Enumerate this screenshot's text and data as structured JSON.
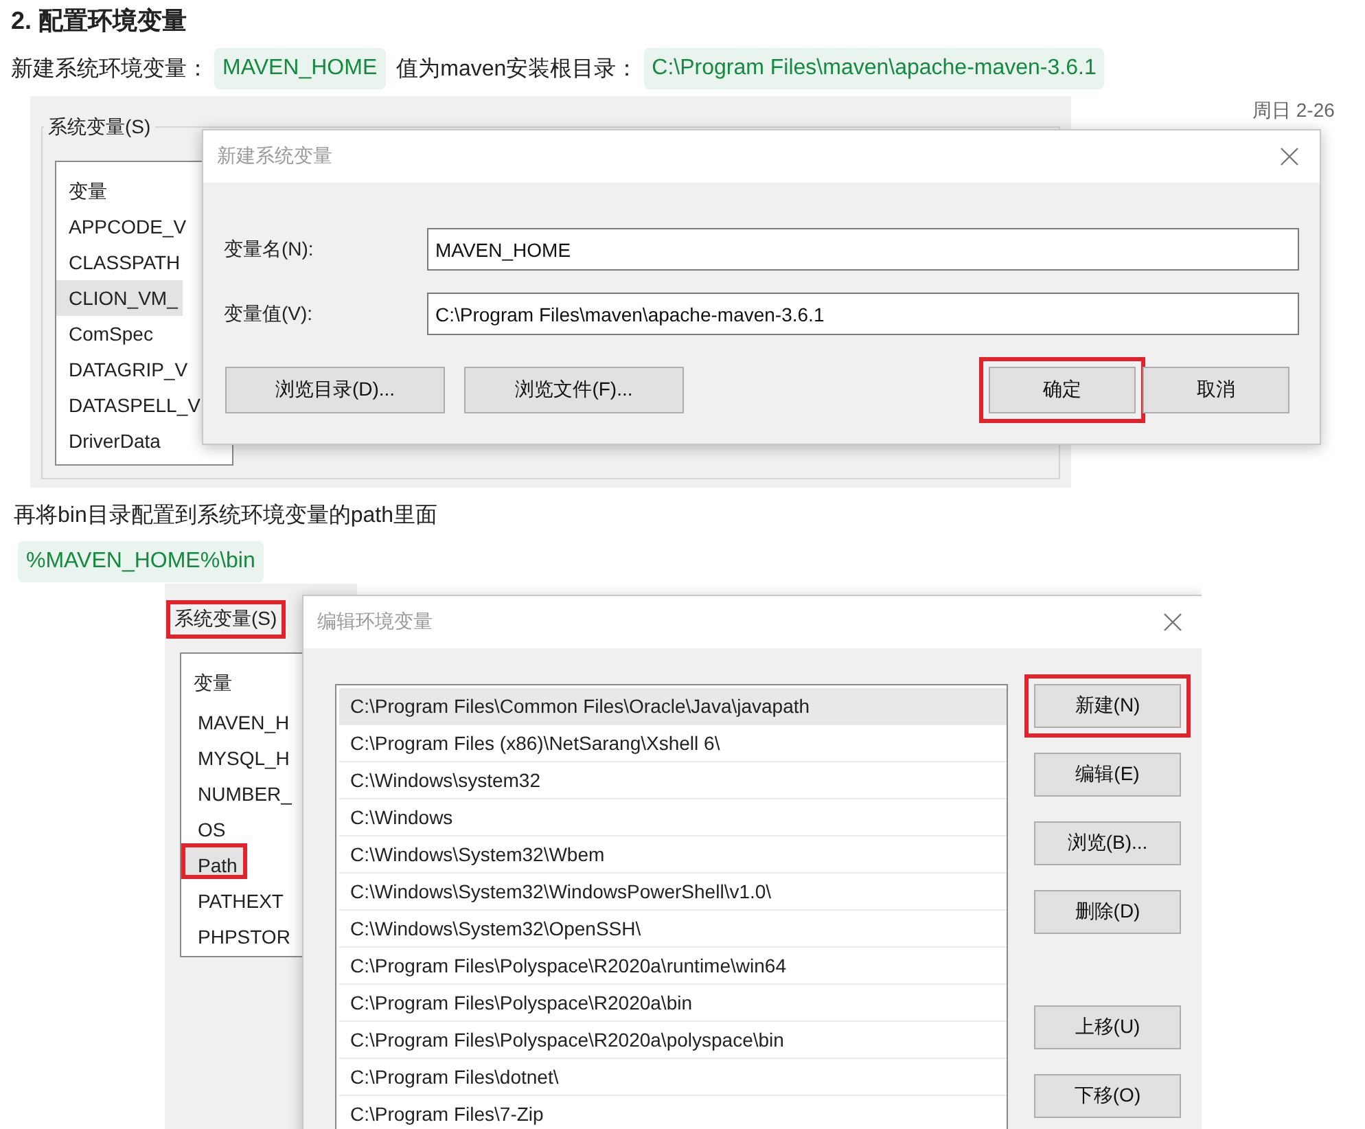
{
  "heading": "2. 配置环境变量",
  "intro": {
    "before": "新建系统环境变量：",
    "name_code": "MAVEN_HOME",
    "middle": "值为maven安装根目录：",
    "value_code": "C:\\Program Files\\maven\\apache-maven-3.6.1"
  },
  "screenshot_1": {
    "clock": "周日 2-26",
    "group_label": "系统变量(S)",
    "list_header": "变量",
    "variables": [
      {
        "name": "APPCODE_V",
        "selected": false
      },
      {
        "name": "CLASSPATH",
        "selected": false
      },
      {
        "name": "CLION_VM_",
        "selected": true
      },
      {
        "name": "ComSpec",
        "selected": false
      },
      {
        "name": "DATAGRIP_V",
        "selected": false
      },
      {
        "name": "DATASPELL_V",
        "selected": false
      },
      {
        "name": "DriverData",
        "selected": false
      }
    ],
    "dialog": {
      "title": "新建系统变量",
      "fields": [
        {
          "label": "变量名(N):",
          "value": "MAVEN_HOME"
        },
        {
          "label": "变量值(V):",
          "value": "C:\\Program Files\\maven\\apache-maven-3.6.1"
        }
      ],
      "buttons": [
        {
          "label": "浏览目录(D)...",
          "highlighted": false
        },
        {
          "label": "浏览文件(F)...",
          "highlighted": false
        },
        {
          "label": "确定",
          "highlighted": true
        },
        {
          "label": "取消",
          "highlighted": false
        }
      ]
    }
  },
  "step_2": "再将bin目录配置到系统环境变量的path里面",
  "path_code": "%MAVEN_HOME%\\bin",
  "screenshot_2": {
    "group_label": "系统变量(S)",
    "group_label_highlighted": true,
    "list_header": "变量",
    "variables": [
      {
        "name": "MAVEN_H",
        "selected": false,
        "highlighted": false
      },
      {
        "name": "MYSQL_H",
        "selected": false,
        "highlighted": false
      },
      {
        "name": "NUMBER_",
        "selected": false,
        "highlighted": false
      },
      {
        "name": "OS",
        "selected": false,
        "highlighted": false
      },
      {
        "name": "Path",
        "selected": true,
        "highlighted": true
      },
      {
        "name": "PATHEXT",
        "selected": false,
        "highlighted": false
      },
      {
        "name": "PHPSTOR",
        "selected": false,
        "highlighted": false
      }
    ],
    "dialog": {
      "title": "编辑环境变量",
      "paths": [
        {
          "text": "C:\\Program Files\\Common Files\\Oracle\\Java\\javapath",
          "selected": true
        },
        {
          "text": "C:\\Program Files (x86)\\NetSarang\\Xshell 6\\",
          "selected": false
        },
        {
          "text": "C:\\Windows\\system32",
          "selected": false
        },
        {
          "text": "C:\\Windows",
          "selected": false
        },
        {
          "text": "C:\\Windows\\System32\\Wbem",
          "selected": false
        },
        {
          "text": "C:\\Windows\\System32\\WindowsPowerShell\\v1.0\\",
          "selected": false
        },
        {
          "text": "C:\\Windows\\System32\\OpenSSH\\",
          "selected": false
        },
        {
          "text": "C:\\Program Files\\Polyspace\\R2020a\\runtime\\win64",
          "selected": false
        },
        {
          "text": "C:\\Program Files\\Polyspace\\R2020a\\bin",
          "selected": false
        },
        {
          "text": "C:\\Program Files\\Polyspace\\R2020a\\polyspace\\bin",
          "selected": false
        },
        {
          "text": "C:\\Program Files\\dotnet\\",
          "selected": false
        },
        {
          "text": "C:\\Program Files\\7-Zip",
          "selected": false
        }
      ],
      "buttons": [
        {
          "label": "新建(N)",
          "highlighted": true
        },
        {
          "label": "编辑(E)",
          "highlighted": false
        },
        {
          "label": "浏览(B)...",
          "highlighted": false
        },
        {
          "label": "删除(D)",
          "highlighted": false
        },
        {
          "label": "上移(U)",
          "highlighted": false
        },
        {
          "label": "下移(O)",
          "highlighted": false
        }
      ]
    }
  }
}
